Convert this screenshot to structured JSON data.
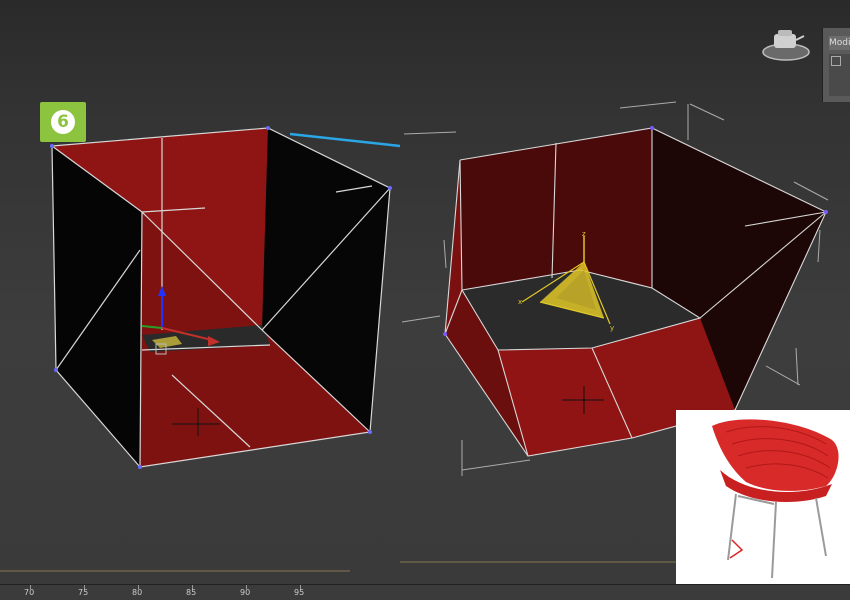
{
  "step_badge": {
    "label": "6"
  },
  "modify_panel": {
    "tab_label": "Modif"
  },
  "timeline": {
    "tick_labels": [
      "70",
      "75",
      "80",
      "85",
      "90",
      "95"
    ]
  },
  "colors": {
    "mesh_red": "#8e1514",
    "mesh_dark": "#050505",
    "wire": "#d8d8d8",
    "connector_line": "#2aa6e6",
    "badge_green": "#8cc43f",
    "gizmo_yellow": "#e0c828"
  },
  "icons": [
    "viewcube-teapot-icon",
    "move-gizmo-icon",
    "pivot-gizmo-icon"
  ]
}
